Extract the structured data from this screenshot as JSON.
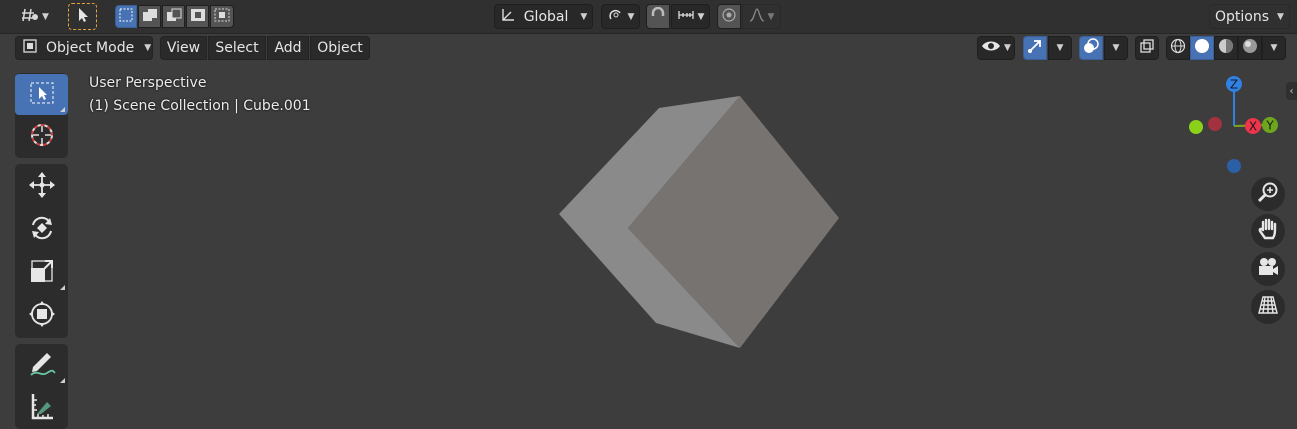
{
  "header": {
    "transform_orientation": "Global",
    "options_label": "Options"
  },
  "menubar": {
    "mode_label": "Object Mode",
    "menus": [
      "View",
      "Select",
      "Add",
      "Object"
    ]
  },
  "viewport": {
    "view_name": "User Perspective",
    "collection_info": "(1) Scene Collection | Cube.001"
  },
  "gizmo": {
    "axes": [
      {
        "label": "Z",
        "color": "#2f81e6"
      },
      {
        "label": "X",
        "color": "#f0344c"
      },
      {
        "label": "Y",
        "color": "#6ea61e"
      }
    ]
  },
  "toolbar": {
    "tools": [
      {
        "name": "select-box-tool",
        "icon": "cursor-select-icon",
        "active": true
      },
      {
        "name": "cursor-tool",
        "icon": "3d-cursor-icon",
        "active": false
      },
      {
        "name": "move-tool",
        "icon": "move-icon",
        "active": false
      },
      {
        "name": "rotate-tool",
        "icon": "rotate-icon",
        "active": false
      },
      {
        "name": "scale-tool",
        "icon": "scale-icon",
        "active": false
      },
      {
        "name": "transform-tool",
        "icon": "transform-icon",
        "active": false
      },
      {
        "name": "annotate-tool",
        "icon": "annotate-pencil-icon",
        "active": false
      },
      {
        "name": "measure-tool",
        "icon": "ruler-icon",
        "active": false
      }
    ]
  },
  "navigation": [
    "zoom-icon",
    "hand-pan-icon",
    "camera-icon",
    "grid-perspective-icon"
  ],
  "colors": {
    "accent": "#4772b3",
    "header_bg": "#303030",
    "viewport_bg": "#3d3d3d",
    "cube_light": "#8a8a8a",
    "cube_dark": "#767370"
  }
}
